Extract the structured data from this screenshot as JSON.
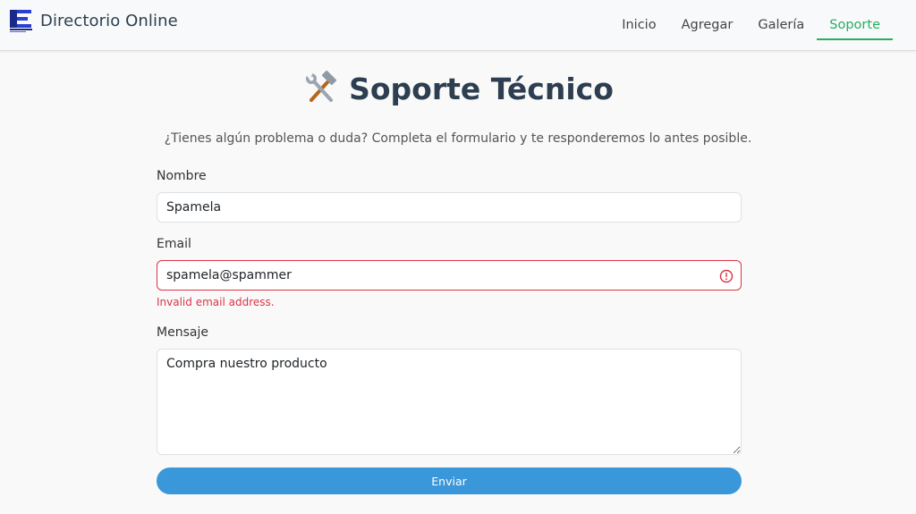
{
  "brand": {
    "name": "Directorio Online",
    "logo_icon": "directory-logo-icon"
  },
  "nav": {
    "items": [
      {
        "label": "Inicio"
      },
      {
        "label": "Agregar"
      },
      {
        "label": "Galería"
      },
      {
        "label": "Soporte",
        "active": true
      }
    ],
    "active_color": "#27ae60"
  },
  "page": {
    "title": "Soporte Técnico",
    "title_icon": "tools-icon",
    "subtitle": "¿Tienes algún problema o duda? Completa el formulario y te responderemos lo antes posible."
  },
  "form": {
    "name": {
      "label": "Nombre",
      "value": "Spamela"
    },
    "email": {
      "label": "Email",
      "value": "spamela@spammer",
      "error": "Invalid email address.",
      "error_color": "#dc3545"
    },
    "message": {
      "label": "Mensaje",
      "value": "Compra nuestro producto"
    },
    "submit_label": "Enviar",
    "submit_color": "#3a97d9"
  }
}
